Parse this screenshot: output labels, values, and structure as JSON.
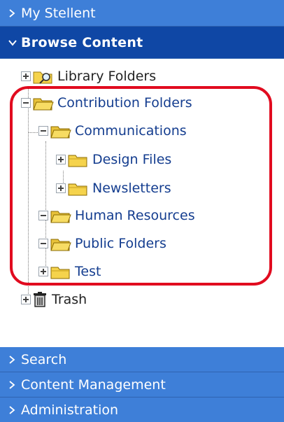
{
  "colors": {
    "header_bg": "#3e7fd8",
    "header_active_bg": "#0f47a5",
    "highlight": "#e10b1f",
    "folder_fill": "#f5d34c"
  },
  "headers": {
    "my_stellent": "My Stellent",
    "browse_content": "Browse Content",
    "search": "Search",
    "content_management": "Content Management",
    "administration": "Administration"
  },
  "tree": {
    "library_folders": "Library Folders",
    "contribution_folders": "Contribution Folders",
    "communications": "Communications",
    "design_files": "Design Files",
    "newsletters": "Newsletters",
    "human_resources": "Human Resources",
    "public_folders": "Public Folders",
    "test": "Test",
    "trash": "Trash"
  }
}
